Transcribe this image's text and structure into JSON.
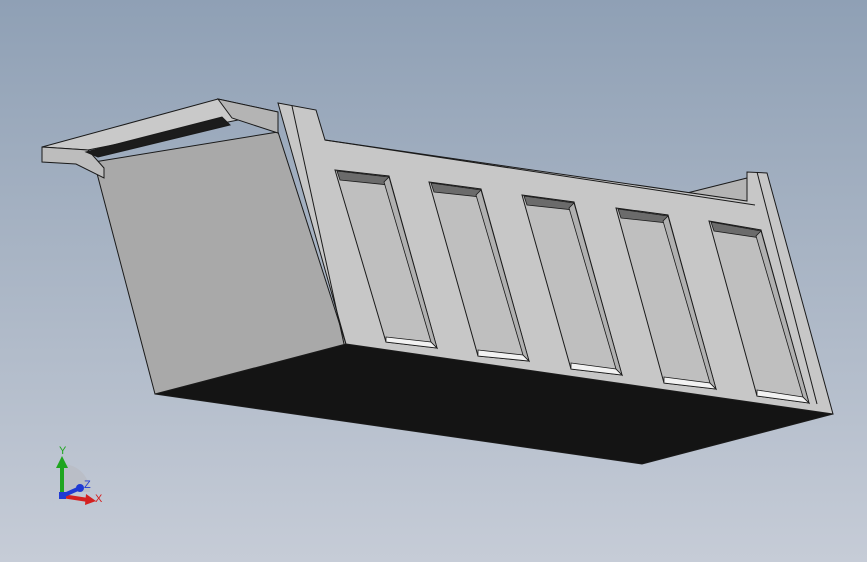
{
  "viewport": {
    "background_top": "#8fa0b5",
    "background_bottom": "#c6ccd7"
  },
  "model": {
    "part": "dump-truck-body",
    "face_colors": {
      "light": "#c7c7c7",
      "mid": "#b4b4b4",
      "shade": "#a9a9a9",
      "dark": "#141414",
      "edge": "#1a1a1a",
      "slot_shadow": "#6b6b6b",
      "slot_highlight": "#f2f2f2"
    },
    "side_panel_count": 5
  },
  "triad": {
    "x_label": "X",
    "y_label": "Y",
    "z_label": "Z",
    "x_color": "#d42020",
    "y_color": "#1fa51f",
    "z_color": "#1f3ad4"
  }
}
